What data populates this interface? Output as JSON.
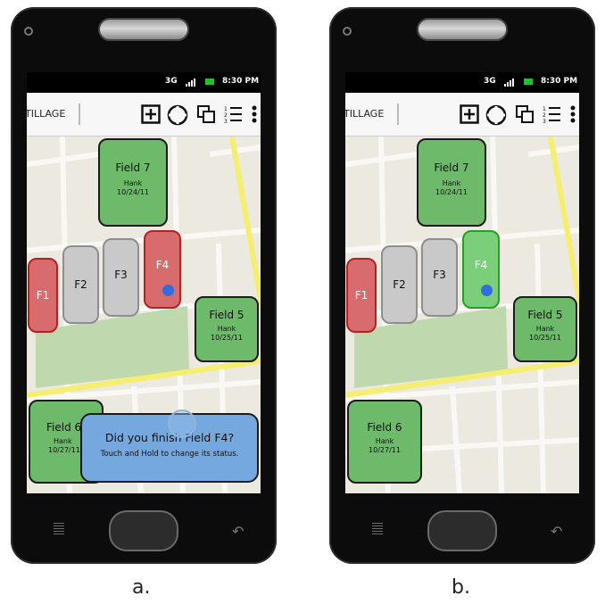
{
  "phone_a": {
    "status": {
      "network": "3G",
      "time": "8:30 PM"
    },
    "app_title": "TILLAGE",
    "fields": {
      "f7": {
        "name": "Field 7",
        "owner": "Hank",
        "date": "10/24/11"
      },
      "f1": {
        "name": "F1"
      },
      "f2": {
        "name": "F2"
      },
      "f3": {
        "name": "F3"
      },
      "f4": {
        "name": "F4"
      },
      "f5": {
        "name": "Field 5",
        "owner": "Hank",
        "date": "10/25/11"
      },
      "f6": {
        "name": "Field 6",
        "owner": "Hank",
        "date": "10/27/11"
      }
    },
    "toast": {
      "title": "Did you finish Field F4?",
      "subtitle": "Touch and Hold to change its status."
    }
  },
  "phone_b": {
    "status": {
      "network": "3G",
      "time": "8:30 PM"
    },
    "app_title": "TILLAGE",
    "fields": {
      "f7": {
        "name": "Field 7",
        "owner": "Hank",
        "date": "10/24/11"
      },
      "f1": {
        "name": "F1"
      },
      "f2": {
        "name": "F2"
      },
      "f3": {
        "name": "F3"
      },
      "f4": {
        "name": "F4"
      },
      "f5": {
        "name": "Field 5",
        "owner": "Hank",
        "date": "10/25/11"
      },
      "f6": {
        "name": "Field 6",
        "owner": "Hank",
        "date": "10/27/11"
      }
    }
  },
  "captions": {
    "a": "a.",
    "b": "b."
  },
  "colors": {
    "field_done": "#6dbb6a",
    "field_pending": "#d76b6d",
    "field_idle": "#c9c9c9",
    "field_selected": "#7ccf7a",
    "road_highlight": "#f5ee6e",
    "toast": "#75a8df"
  }
}
